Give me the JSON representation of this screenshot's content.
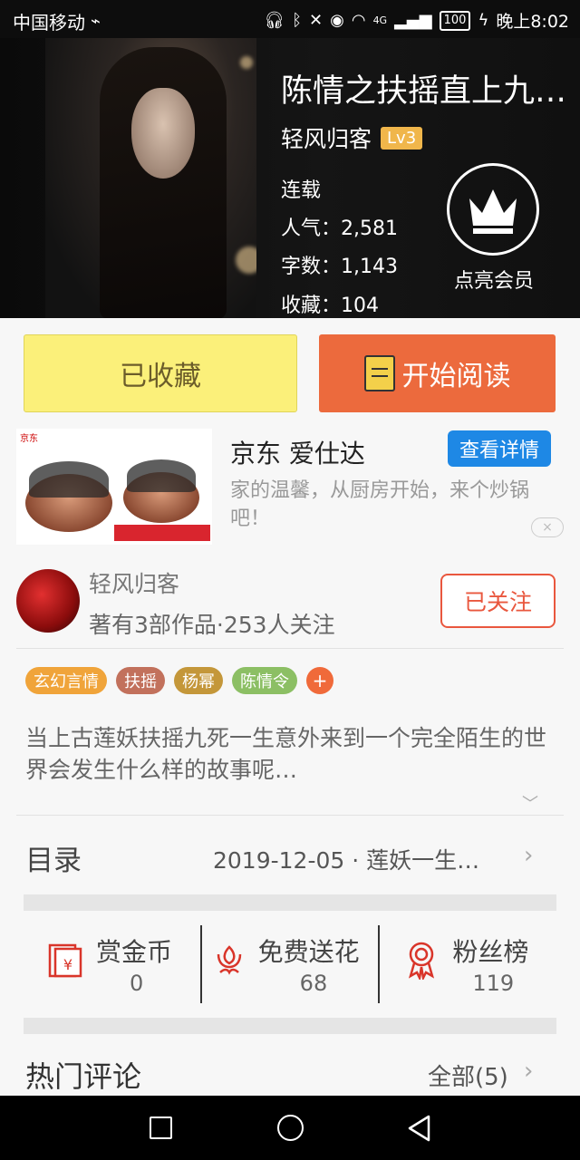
{
  "status_bar": {
    "carrier": "中国移动",
    "network": "4G",
    "battery": "100",
    "time": "晚上8:02"
  },
  "book": {
    "title": "陈情之扶摇直上九…",
    "author": "轻风归客",
    "level": "Lv3",
    "status": "连载",
    "popularity": "人气：2,581",
    "words": "字数：1,143",
    "favorites": "收藏：104",
    "vip_label": "点亮会员"
  },
  "actions": {
    "collected_label": "已收藏",
    "read_label": "开始阅读"
  },
  "ad": {
    "brand_text": "京东",
    "title": "京东 爱仕达",
    "detail_label": "查看详情",
    "description": "家的温馨，从厨房开始，来个炒锅吧！",
    "close_symbol": "×"
  },
  "author_card": {
    "name": "轻风归客",
    "works": "著有3部作品·253人关注",
    "follow_label": "已关注"
  },
  "tags": [
    {
      "label": "玄幻言情",
      "color": "#f0a43a"
    },
    {
      "label": "扶摇",
      "color": "#c2715c"
    },
    {
      "label": "杨幂",
      "color": "#c4973a"
    },
    {
      "label": "陈情令",
      "color": "#8cbf64"
    }
  ],
  "tag_add": "+",
  "synopsis": "当上古莲妖扶摇九死一生意外来到一个完全陌生的世界会发生什么样的故事呢…",
  "toc": {
    "title": "目录",
    "latest": "2019-12-05 · 莲妖一生…"
  },
  "stats": [
    {
      "label": "赏金币",
      "value": "0",
      "icon": "red-envelope-icon"
    },
    {
      "label": "免费送花",
      "value": "68",
      "icon": "flower-icon"
    },
    {
      "label": "粉丝榜",
      "value": "119",
      "icon": "medal-icon"
    }
  ],
  "comments": {
    "title": "热门评论",
    "all_label": "全部(5)"
  },
  "colors": {
    "accent": "#ec6a3d",
    "collected_bg": "#fbf07a",
    "ad_button": "#1e88e5",
    "follow": "#e9573e"
  }
}
